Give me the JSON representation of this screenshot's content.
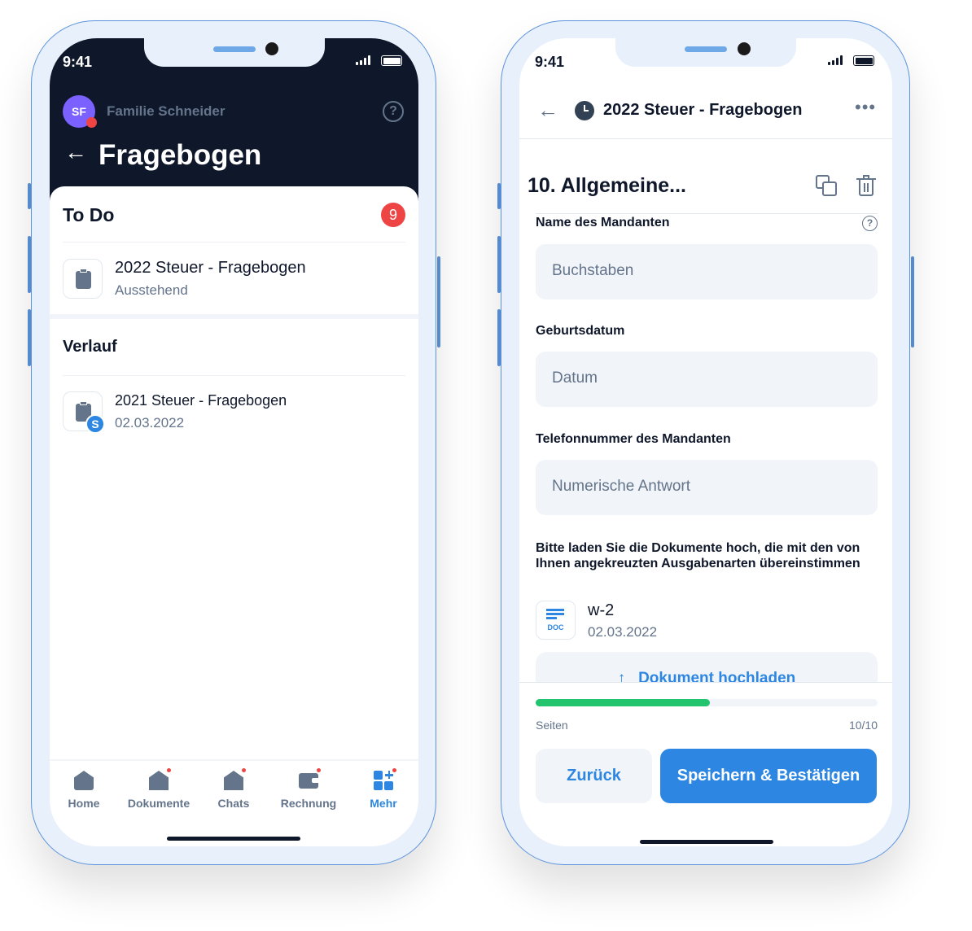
{
  "status": {
    "time": "9:41"
  },
  "left": {
    "user": {
      "initials": "SF",
      "name": "Familie Schneider"
    },
    "title": "Fragebogen",
    "todo": {
      "heading": "To Do",
      "badge": "9",
      "item": {
        "title": "2022 Steuer - Fragebogen",
        "status": "Ausstehend"
      }
    },
    "history": {
      "heading": "Verlauf",
      "item": {
        "title": "2021 Steuer - Fragebogen",
        "date": "02.03.2022",
        "badge": "S"
      }
    },
    "nav": [
      {
        "label": "Home",
        "icon": "house-icon"
      },
      {
        "label": "Dokumente",
        "icon": "house-icon"
      },
      {
        "label": "Chats",
        "icon": "house-icon"
      },
      {
        "label": "Rechnung",
        "icon": "wallet-icon"
      },
      {
        "label": "Mehr",
        "icon": "grid-plus-icon",
        "active": true
      }
    ]
  },
  "right": {
    "header": {
      "title": "2022 Steuer - Fragebogen"
    },
    "section": "10. Allgemeine...",
    "fields": [
      {
        "label": "Name des Mandanten",
        "placeholder": "Buchstaben"
      },
      {
        "label": "Geburtsdatum",
        "placeholder": "Datum"
      },
      {
        "label": "Telefonnummer des Mandanten",
        "placeholder": "Numerische Antwort"
      }
    ],
    "upload": {
      "label": "Bitte laden Sie die Dokumente hoch, die mit den von Ihnen angekreuzten Ausgabenarten übereinstimmen",
      "file": {
        "name": "w-2",
        "date": "02.03.2022",
        "type": "DOC"
      },
      "button": "Dokument hochladen"
    },
    "progress": {
      "label": "Seiten",
      "value": "10/10",
      "fill_percent": 51
    },
    "buttons": {
      "back": "Zurück",
      "save": "Speichern & Bestätigen"
    }
  },
  "colors": {
    "primary": "#2d87e2",
    "dark": "#0f172a",
    "progress": "#22c56e",
    "badge": "#ef4444",
    "avatar": "#7b61ff"
  }
}
